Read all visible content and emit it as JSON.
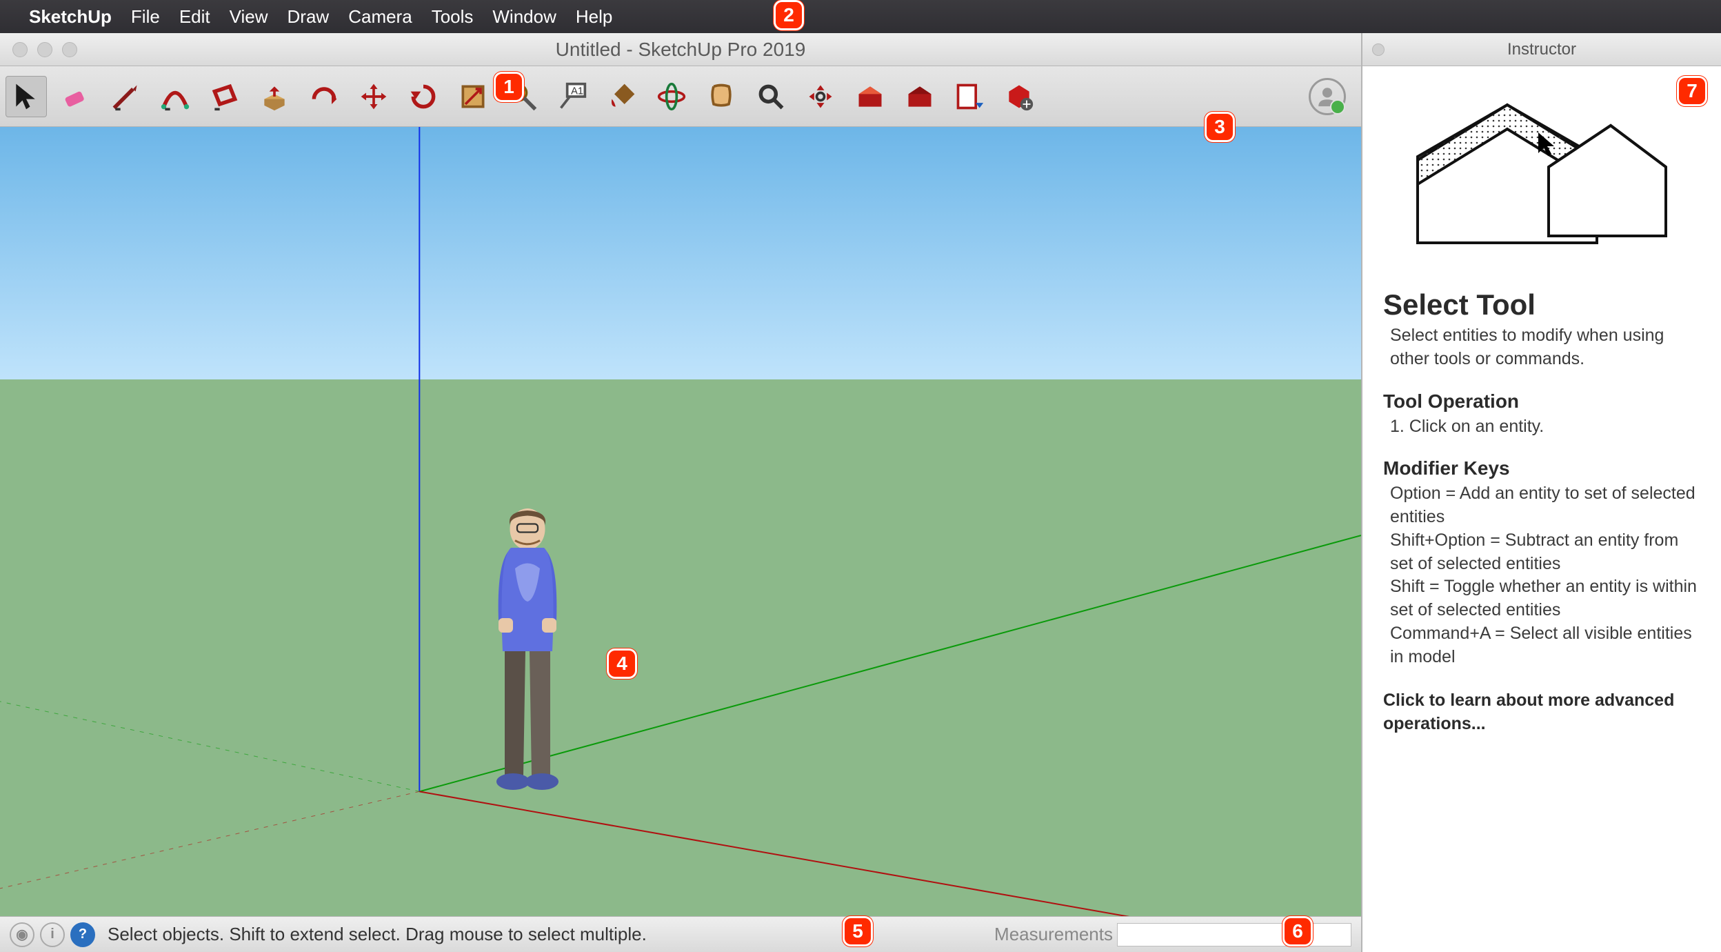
{
  "menubar": {
    "apple": "",
    "app_name": "SketchUp",
    "items": [
      "File",
      "Edit",
      "View",
      "Draw",
      "Camera",
      "Tools",
      "Window",
      "Help"
    ]
  },
  "window": {
    "title": "Untitled - SketchUp Pro 2019"
  },
  "toolbar": {
    "tools": [
      "select",
      "eraser",
      "line",
      "arc",
      "rectangle",
      "push-pull",
      "offset",
      "move",
      "rotate",
      "scale",
      "tape-measure",
      "text",
      "paint-bucket",
      "orbit",
      "walk",
      "zoom",
      "zoom-extents",
      "3d-warehouse-get",
      "3d-warehouse-share",
      "layout",
      "extension-warehouse"
    ]
  },
  "statusbar": {
    "text": "Select objects. Shift to extend select. Drag mouse to select multiple.",
    "measure_label": "Measurements",
    "measure_value": ""
  },
  "instructor": {
    "title": "Instructor",
    "h1": "Select Tool",
    "p1": "Select entities to modify when using other tools or commands.",
    "h2": "Tool Operation",
    "p2": "1. Click on an entity.",
    "h3": "Modifier Keys",
    "mod1": "Option = Add an entity to set of selected entities",
    "mod2": "Shift+Option = Subtract an entity from set of selected entities",
    "mod3": "Shift = Toggle whether an entity is within set of selected entities",
    "mod4": "Command+A = Select all visible entities in model",
    "link": "Click to learn about more advanced operations..."
  },
  "callouts": {
    "c1": "1",
    "c2": "2",
    "c3": "3",
    "c4": "4",
    "c5": "5",
    "c6": "6",
    "c7": "7"
  }
}
